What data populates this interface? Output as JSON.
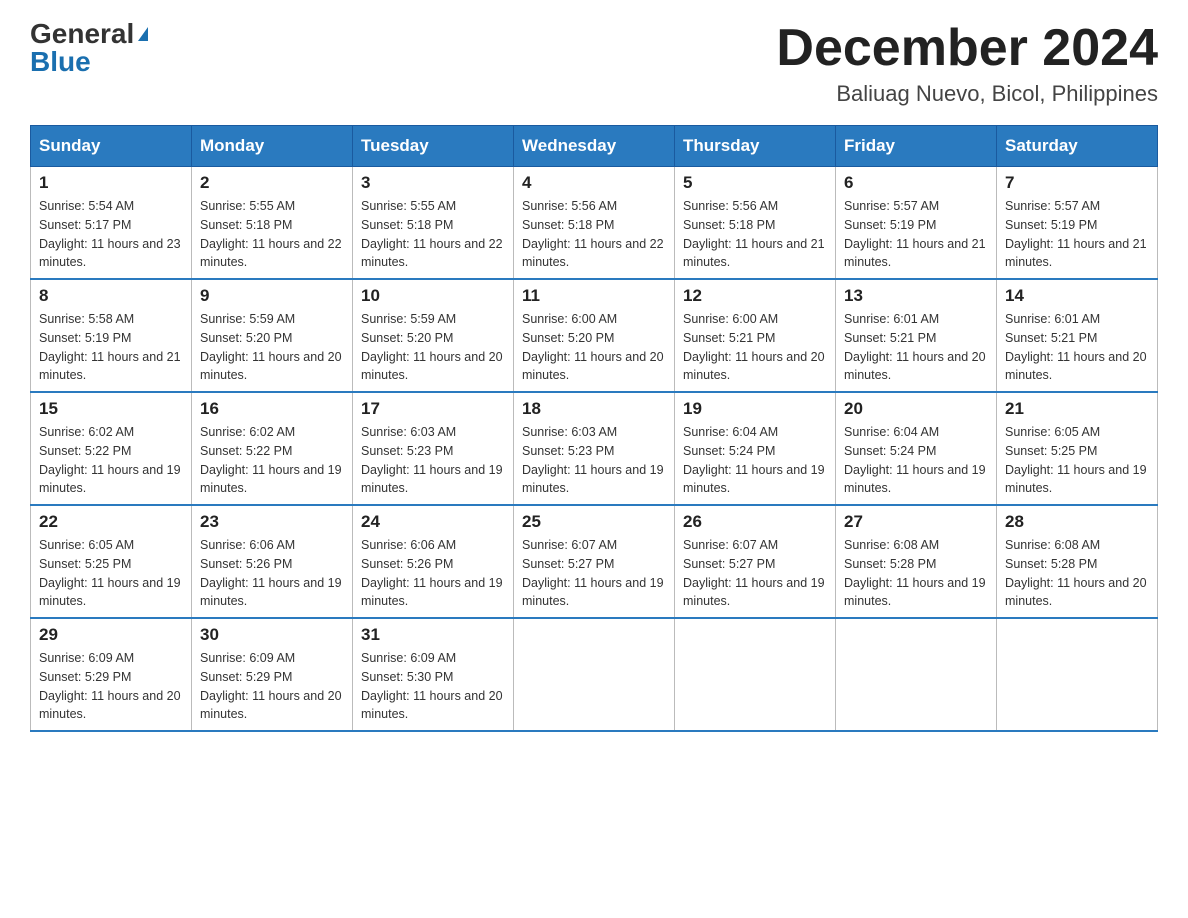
{
  "header": {
    "logo_general": "General",
    "logo_blue": "Blue",
    "month_title": "December 2024",
    "location": "Baliuag Nuevo, Bicol, Philippines"
  },
  "days_of_week": [
    "Sunday",
    "Monday",
    "Tuesday",
    "Wednesday",
    "Thursday",
    "Friday",
    "Saturday"
  ],
  "weeks": [
    [
      {
        "day": "1",
        "sunrise": "5:54 AM",
        "sunset": "5:17 PM",
        "daylight": "11 hours and 23 minutes."
      },
      {
        "day": "2",
        "sunrise": "5:55 AM",
        "sunset": "5:18 PM",
        "daylight": "11 hours and 22 minutes."
      },
      {
        "day": "3",
        "sunrise": "5:55 AM",
        "sunset": "5:18 PM",
        "daylight": "11 hours and 22 minutes."
      },
      {
        "day": "4",
        "sunrise": "5:56 AM",
        "sunset": "5:18 PM",
        "daylight": "11 hours and 22 minutes."
      },
      {
        "day": "5",
        "sunrise": "5:56 AM",
        "sunset": "5:18 PM",
        "daylight": "11 hours and 21 minutes."
      },
      {
        "day": "6",
        "sunrise": "5:57 AM",
        "sunset": "5:19 PM",
        "daylight": "11 hours and 21 minutes."
      },
      {
        "day": "7",
        "sunrise": "5:57 AM",
        "sunset": "5:19 PM",
        "daylight": "11 hours and 21 minutes."
      }
    ],
    [
      {
        "day": "8",
        "sunrise": "5:58 AM",
        "sunset": "5:19 PM",
        "daylight": "11 hours and 21 minutes."
      },
      {
        "day": "9",
        "sunrise": "5:59 AM",
        "sunset": "5:20 PM",
        "daylight": "11 hours and 20 minutes."
      },
      {
        "day": "10",
        "sunrise": "5:59 AM",
        "sunset": "5:20 PM",
        "daylight": "11 hours and 20 minutes."
      },
      {
        "day": "11",
        "sunrise": "6:00 AM",
        "sunset": "5:20 PM",
        "daylight": "11 hours and 20 minutes."
      },
      {
        "day": "12",
        "sunrise": "6:00 AM",
        "sunset": "5:21 PM",
        "daylight": "11 hours and 20 minutes."
      },
      {
        "day": "13",
        "sunrise": "6:01 AM",
        "sunset": "5:21 PM",
        "daylight": "11 hours and 20 minutes."
      },
      {
        "day": "14",
        "sunrise": "6:01 AM",
        "sunset": "5:21 PM",
        "daylight": "11 hours and 20 minutes."
      }
    ],
    [
      {
        "day": "15",
        "sunrise": "6:02 AM",
        "sunset": "5:22 PM",
        "daylight": "11 hours and 19 minutes."
      },
      {
        "day": "16",
        "sunrise": "6:02 AM",
        "sunset": "5:22 PM",
        "daylight": "11 hours and 19 minutes."
      },
      {
        "day": "17",
        "sunrise": "6:03 AM",
        "sunset": "5:23 PM",
        "daylight": "11 hours and 19 minutes."
      },
      {
        "day": "18",
        "sunrise": "6:03 AM",
        "sunset": "5:23 PM",
        "daylight": "11 hours and 19 minutes."
      },
      {
        "day": "19",
        "sunrise": "6:04 AM",
        "sunset": "5:24 PM",
        "daylight": "11 hours and 19 minutes."
      },
      {
        "day": "20",
        "sunrise": "6:04 AM",
        "sunset": "5:24 PM",
        "daylight": "11 hours and 19 minutes."
      },
      {
        "day": "21",
        "sunrise": "6:05 AM",
        "sunset": "5:25 PM",
        "daylight": "11 hours and 19 minutes."
      }
    ],
    [
      {
        "day": "22",
        "sunrise": "6:05 AM",
        "sunset": "5:25 PM",
        "daylight": "11 hours and 19 minutes."
      },
      {
        "day": "23",
        "sunrise": "6:06 AM",
        "sunset": "5:26 PM",
        "daylight": "11 hours and 19 minutes."
      },
      {
        "day": "24",
        "sunrise": "6:06 AM",
        "sunset": "5:26 PM",
        "daylight": "11 hours and 19 minutes."
      },
      {
        "day": "25",
        "sunrise": "6:07 AM",
        "sunset": "5:27 PM",
        "daylight": "11 hours and 19 minutes."
      },
      {
        "day": "26",
        "sunrise": "6:07 AM",
        "sunset": "5:27 PM",
        "daylight": "11 hours and 19 minutes."
      },
      {
        "day": "27",
        "sunrise": "6:08 AM",
        "sunset": "5:28 PM",
        "daylight": "11 hours and 19 minutes."
      },
      {
        "day": "28",
        "sunrise": "6:08 AM",
        "sunset": "5:28 PM",
        "daylight": "11 hours and 20 minutes."
      }
    ],
    [
      {
        "day": "29",
        "sunrise": "6:09 AM",
        "sunset": "5:29 PM",
        "daylight": "11 hours and 20 minutes."
      },
      {
        "day": "30",
        "sunrise": "6:09 AM",
        "sunset": "5:29 PM",
        "daylight": "11 hours and 20 minutes."
      },
      {
        "day": "31",
        "sunrise": "6:09 AM",
        "sunset": "5:30 PM",
        "daylight": "11 hours and 20 minutes."
      },
      null,
      null,
      null,
      null
    ]
  ]
}
